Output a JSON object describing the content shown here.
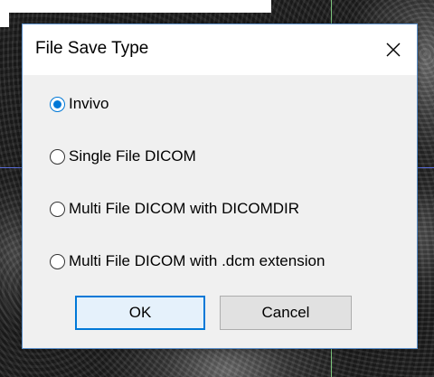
{
  "dialog": {
    "title": "File Save Type",
    "close_glyph": "X",
    "options": [
      {
        "label": "Invivo",
        "checked": true
      },
      {
        "label": "Single File DICOM",
        "checked": false
      },
      {
        "label": "Multi File DICOM with DICOMDIR",
        "checked": false
      },
      {
        "label": "Multi File DICOM with .dcm extension",
        "checked": false
      }
    ],
    "buttons": {
      "ok_label": "OK",
      "cancel_label": "Cancel"
    }
  },
  "colors": {
    "accent": "#0078d7",
    "dialog_bg": "#f0f0f0",
    "crosshair_vertical": "#7cc47c",
    "crosshair_horizontal": "#5a6dd8"
  },
  "icons": {
    "close": "close-icon",
    "radio_selected": "radio-checked-icon",
    "radio_unselected": "radio-unchecked-icon"
  }
}
